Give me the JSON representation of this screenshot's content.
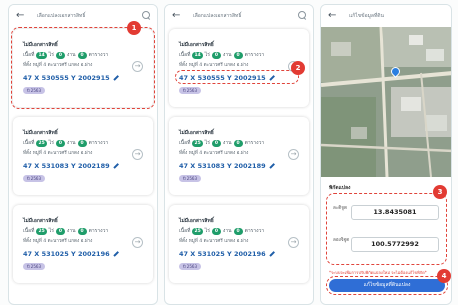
{
  "screens": {
    "list": {
      "title": "เลือกแปลงเอกสารสิทธิ์",
      "back_icon": "back-arrow-icon",
      "search_icon": "search-icon"
    },
    "edit": {
      "title": "แก้ไขข้อมูลที่ดิน",
      "back_icon": "back-arrow-icon"
    }
  },
  "screen1": {
    "cards": [
      {
        "title": "ไม่มีเอกสารสิทธิ์",
        "area_prefix": "เนื้อที่",
        "rai": "14",
        "rai_unit": "ไร่",
        "ngan": "0",
        "ngan_unit": "งาน",
        "wa": "0",
        "wa_unit": "ตารางวา",
        "address": "ที่ตั้ง หมู่ที่ 4 ตะนาวศรี แกดง อ.ฝาง",
        "coords": "47 X 530555 Y 2002915",
        "badge": "ปี 2563"
      },
      {
        "title": "ไม่มีเอกสารสิทธิ์",
        "area_prefix": "เนื้อที่",
        "rai": "25",
        "rai_unit": "ไร่",
        "ngan": "0",
        "ngan_unit": "งาน",
        "wa": "0",
        "wa_unit": "ตารางวา",
        "address": "ที่ตั้ง หมู่ที่ 4 ตะนาวศรี แกดง อ.ฝาง",
        "coords": "47 X 531083 Y 2002189",
        "badge": "ปี 2563"
      },
      {
        "title": "ไม่มีเอกสารสิทธิ์",
        "area_prefix": "เนื้อที่",
        "rai": "25",
        "rai_unit": "ไร่",
        "ngan": "0",
        "ngan_unit": "งาน",
        "wa": "0",
        "wa_unit": "ตารางวา",
        "address": "ที่ตั้ง หมู่ที่ 4 ตะนาวศรี แกดง อ.ฝาง",
        "coords": "47 X 531025 Y 2002196",
        "badge": "ปี 2563"
      }
    ]
  },
  "screen2": {
    "cards": [
      {
        "title": "ไม่มีเอกสารสิทธิ์",
        "area_prefix": "เนื้อที่",
        "rai": "14",
        "rai_unit": "ไร่",
        "ngan": "0",
        "ngan_unit": "งาน",
        "wa": "0",
        "wa_unit": "ตารางวา",
        "address": "ที่ตั้ง หมู่ที่ 4 ตะนาวศรี แกดง อ.ฝาง",
        "coords": "47 X 530555 Y 2002915",
        "badge": "ปี 2563"
      },
      {
        "title": "ไม่มีเอกสารสิทธิ์",
        "area_prefix": "เนื้อที่",
        "rai": "25",
        "rai_unit": "ไร่",
        "ngan": "0",
        "ngan_unit": "งาน",
        "wa": "0",
        "wa_unit": "ตารางวา",
        "address": "ที่ตั้ง หมู่ที่ 4 ตะนาวศรี แกดง อ.ฝาง",
        "coords": "47 X 531083 Y 2002189",
        "badge": "ปี 2563"
      },
      {
        "title": "ไม่มีเอกสารสิทธิ์",
        "area_prefix": "เนื้อที่",
        "rai": "25",
        "rai_unit": "ไร่",
        "ngan": "0",
        "ngan_unit": "งาน",
        "wa": "0",
        "wa_unit": "ตารางวา",
        "address": "ที่ตั้ง หมู่ที่ 4 ตะนาวศรี แกดง อ.ฝาง",
        "coords": "47 X 531025 Y 2002196",
        "badge": "ปี 2563"
      }
    ]
  },
  "edit_form": {
    "section_title": "พิกัดแปลง",
    "lat_label": "ละติจูด",
    "lat_value": "13.8435081",
    "lon_label": "ลองจิจูด",
    "lon_value": "100.5772992",
    "hint": "*ระบบจะเพิ่มการปรับพิกัดแปลงใหม่ จะไม่ต้องแก้ไขพิกัด*",
    "save_label": "แก้ไขข้อมูลที่ดินแปลง"
  },
  "callouts": [
    "1",
    "2",
    "3",
    "4"
  ],
  "colors": {
    "accent_green": "#1f9d6a",
    "link_blue": "#1f5ea8",
    "callout_red": "#e23b33",
    "button_blue": "#2f6ed6"
  }
}
